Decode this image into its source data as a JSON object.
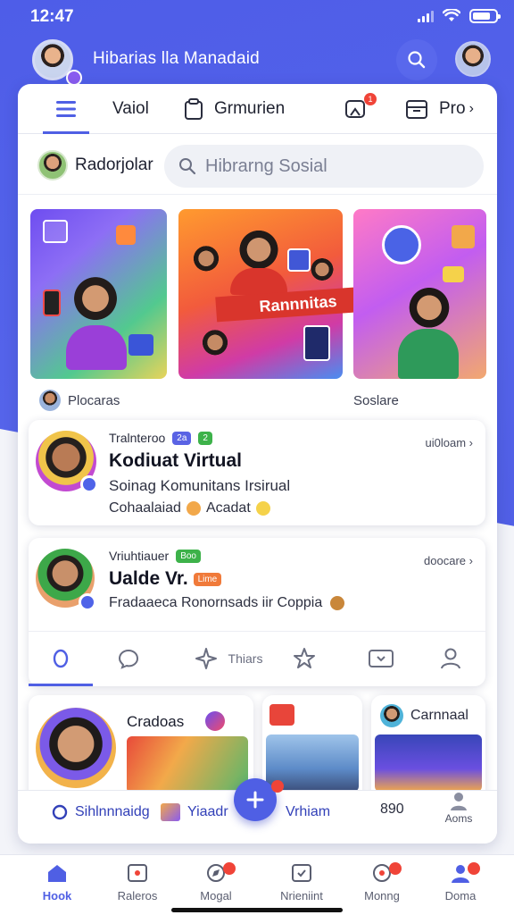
{
  "status_bar": {
    "time": "12:47"
  },
  "header": {
    "title": "Hibarias lla Manadaid"
  },
  "tabs": [
    {
      "label": "Vaiol"
    },
    {
      "label": "Grmurien"
    },
    {
      "label": ""
    },
    {
      "label": "Pro"
    }
  ],
  "notif_count": "1",
  "search_row": {
    "user_name": "Radorjolar",
    "placeholder": "Hibrarng Sosial"
  },
  "media": {
    "caption": "Rannnitas",
    "label_left": "Plocaras",
    "label_right": "Soslare"
  },
  "posts": [
    {
      "meta": "Tralnteroo",
      "tag1": "2a",
      "tag2": "2",
      "title": "Kodiuat Virtual",
      "subtitle": "Soinag Komunitans Irsirual",
      "detail": "Cohaalaiad",
      "detail2": "Acadat",
      "time": "ui0loam"
    },
    {
      "meta": "Vriuhtiauer",
      "tag1": "Boo",
      "tag2": "Lime",
      "title": "Ualde Vr.",
      "subtitle": "Fradaaeca Ronornsads iir Coppia",
      "time": "doocare",
      "actions_label": "Thiars"
    }
  ],
  "bottom_cards": {
    "card1_title": "Cradoas",
    "card3_title": "Carnnaal",
    "strip_left": "Sihlnnnaidg",
    "strip_mid": "Yiaadr",
    "strip_right": "Vrhiam",
    "count": "890",
    "profile_label": "Aoms"
  },
  "bottom_nav": [
    {
      "label": "Hook",
      "icon": "home-icon"
    },
    {
      "label": "Raleros",
      "icon": "gallery-icon"
    },
    {
      "label": "Mogal",
      "icon": "compass-icon"
    },
    {
      "label": "Nrieniint",
      "icon": "inbox-icon"
    },
    {
      "label": "Monng",
      "icon": "clock-icon"
    },
    {
      "label": "Doma",
      "icon": "user-icon"
    }
  ]
}
